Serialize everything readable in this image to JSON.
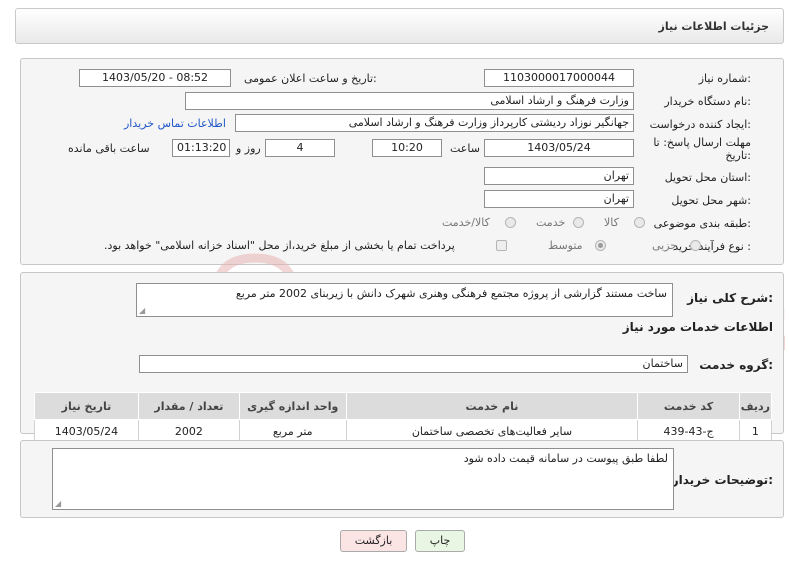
{
  "header": {
    "title": "جزئیات اطلاعات نیاز"
  },
  "fields": {
    "need_number_label": "شماره نیاز:",
    "need_number": "1103000017000044",
    "announce_label": "تاریخ و ساعت اعلان عمومی:",
    "announce_value": "1403/05/20 - 08:52",
    "buyer_org_label": "نام دستگاه خریدار:",
    "buyer_org": "وزارت فرهنگ و ارشاد اسلامی",
    "creator_label": "ایجاد کننده درخواست:",
    "creator": "جهانگیر نوزاد ردیشتی کارپرداز وزارت فرهنگ و ارشاد اسلامی",
    "contact_link": "اطلاعات تماس خریدار",
    "deadline_label": "مهلت ارسال پاسخ: تا تاریخ:",
    "deadline_date": "1403/05/24",
    "time_label": "ساعت",
    "deadline_time": "10:20",
    "days_value": "4",
    "days_label": "روز و",
    "remaining_time": "01:13:20",
    "remaining_label": "ساعت باقی مانده",
    "province_label": "استان محل تحویل:",
    "province": "تهران",
    "city_label": "شهر محل تحویل:",
    "city": "تهران",
    "category_label": "طبقه بندی موضوعی:",
    "category_options": [
      "کالا",
      "خدمت",
      "کالا/خدمت"
    ],
    "process_label": "نوع فرآیند خرید :",
    "process_options": [
      "جزیی",
      "متوسط"
    ],
    "payment_note": "پرداخت تمام یا بخشی از مبلغ خرید،از محل \"اسناد خزانه اسلامی\" خواهد بود."
  },
  "summary": {
    "label": "شرح کلی نیاز:",
    "text": "ساخت مستند گزارشی از پروژه مجتمع فرهنگی وهنری شهرک دانش با زیربنای 2002 متر مربع"
  },
  "services": {
    "section_title": "اطلاعات خدمات مورد نیاز",
    "group_label": "گروه خدمت:",
    "group_value": "ساختمان",
    "columns": [
      "ردیف",
      "کد خدمت",
      "نام خدمت",
      "واحد اندازه گیری",
      "تعداد / مقدار",
      "تاریخ نیاز"
    ],
    "rows": [
      [
        "1",
        "ج-43-439",
        "سایر فعالیت‌های تخصصی ساختمان",
        "متر مربع",
        "2002",
        "1403/05/24"
      ]
    ]
  },
  "buyer_notes": {
    "label": "توضیحات خریدار:",
    "text": "لطفا طبق پیوست در سامانه قیمت داده شود"
  },
  "buttons": {
    "print": "چاپ",
    "back": "بازگشت"
  },
  "watermark": {
    "text": "AriaTender.neT"
  },
  "colors": {
    "link": "#1f56c8",
    "print_bg": "#e9f6e3",
    "back_bg": "#fbe4e4",
    "watermark": "#e8b5b5"
  }
}
